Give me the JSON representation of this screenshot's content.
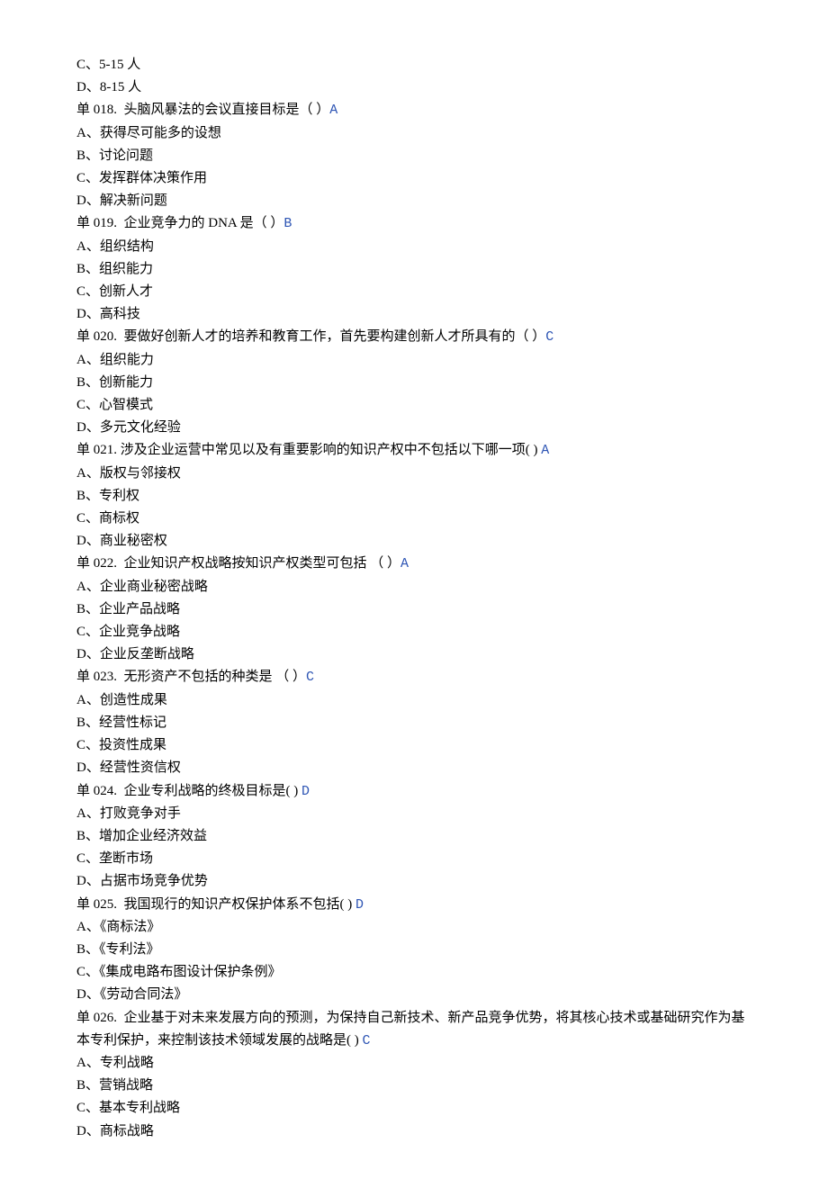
{
  "lines": [
    {
      "text": "C、5-15 人"
    },
    {
      "text": "D、8-15 人"
    },
    {
      "text": "单 018.  头脑风暴法的会议直接目标是（ ）",
      "answer": "A"
    },
    {
      "text": "A、获得尽可能多的设想"
    },
    {
      "text": "B、讨论问题"
    },
    {
      "text": "C、发挥群体决策作用"
    },
    {
      "text": "D、解决新问题"
    },
    {
      "text": "单 019.  企业竞争力的 DNA 是（ ）",
      "answer": "B"
    },
    {
      "text": "A、组织结构"
    },
    {
      "text": "B、组织能力"
    },
    {
      "text": "C、创新人才"
    },
    {
      "text": "D、高科技"
    },
    {
      "text": "单 020.  要做好创新人才的培养和教育工作，首先要构建创新人才所具有的（ ）",
      "answer": "C"
    },
    {
      "text": "A、组织能力"
    },
    {
      "text": "B、创新能力"
    },
    {
      "text": "C、心智模式"
    },
    {
      "text": "D、多元文化经验"
    },
    {
      "text": "单 021. 涉及企业运营中常见以及有重要影响的知识产权中不包括以下哪一项( ) ",
      "answer": "A"
    },
    {
      "text": "A、版权与邻接权"
    },
    {
      "text": "B、专利权"
    },
    {
      "text": "C、商标权"
    },
    {
      "text": "D、商业秘密权"
    },
    {
      "text": "单 022.  企业知识产权战略按知识产权类型可包括 （ ）",
      "answer": "A"
    },
    {
      "text": "A、企业商业秘密战略"
    },
    {
      "text": "B、企业产品战略"
    },
    {
      "text": "C、企业竞争战略"
    },
    {
      "text": "D、企业反垄断战略"
    },
    {
      "text": "单 023.  无形资产不包括的种类是 （ ）",
      "answer": "C"
    },
    {
      "text": "A、创造性成果"
    },
    {
      "text": "B、经营性标记"
    },
    {
      "text": "C、投资性成果"
    },
    {
      "text": "D、经营性资信权"
    },
    {
      "text": "单 024.  企业专利战略的终极目标是( ) ",
      "answer": "D"
    },
    {
      "text": "A、打败竞争对手"
    },
    {
      "text": "B、增加企业经济效益"
    },
    {
      "text": "C、垄断市场"
    },
    {
      "text": "D、占据市场竞争优势"
    },
    {
      "text": "单 025.  我国现行的知识产权保护体系不包括( ) ",
      "answer": "D"
    },
    {
      "text": "A、《商标法》"
    },
    {
      "text": "B、《专利法》"
    },
    {
      "text": "C、《集成电路布图设计保护条例》"
    },
    {
      "text": "D、《劳动合同法》"
    },
    {
      "text": "单 026.  企业基于对未来发展方向的预测，为保持自己新技术、新产品竞争优势，将其核心技术或基础研究作为基本专利保护，来控制该技术领域发展的战略是( ) ",
      "answer": "C"
    },
    {
      "text": "A、专利战略"
    },
    {
      "text": "B、营销战略"
    },
    {
      "text": "C、基本专利战略"
    },
    {
      "text": "D、商标战略"
    }
  ]
}
